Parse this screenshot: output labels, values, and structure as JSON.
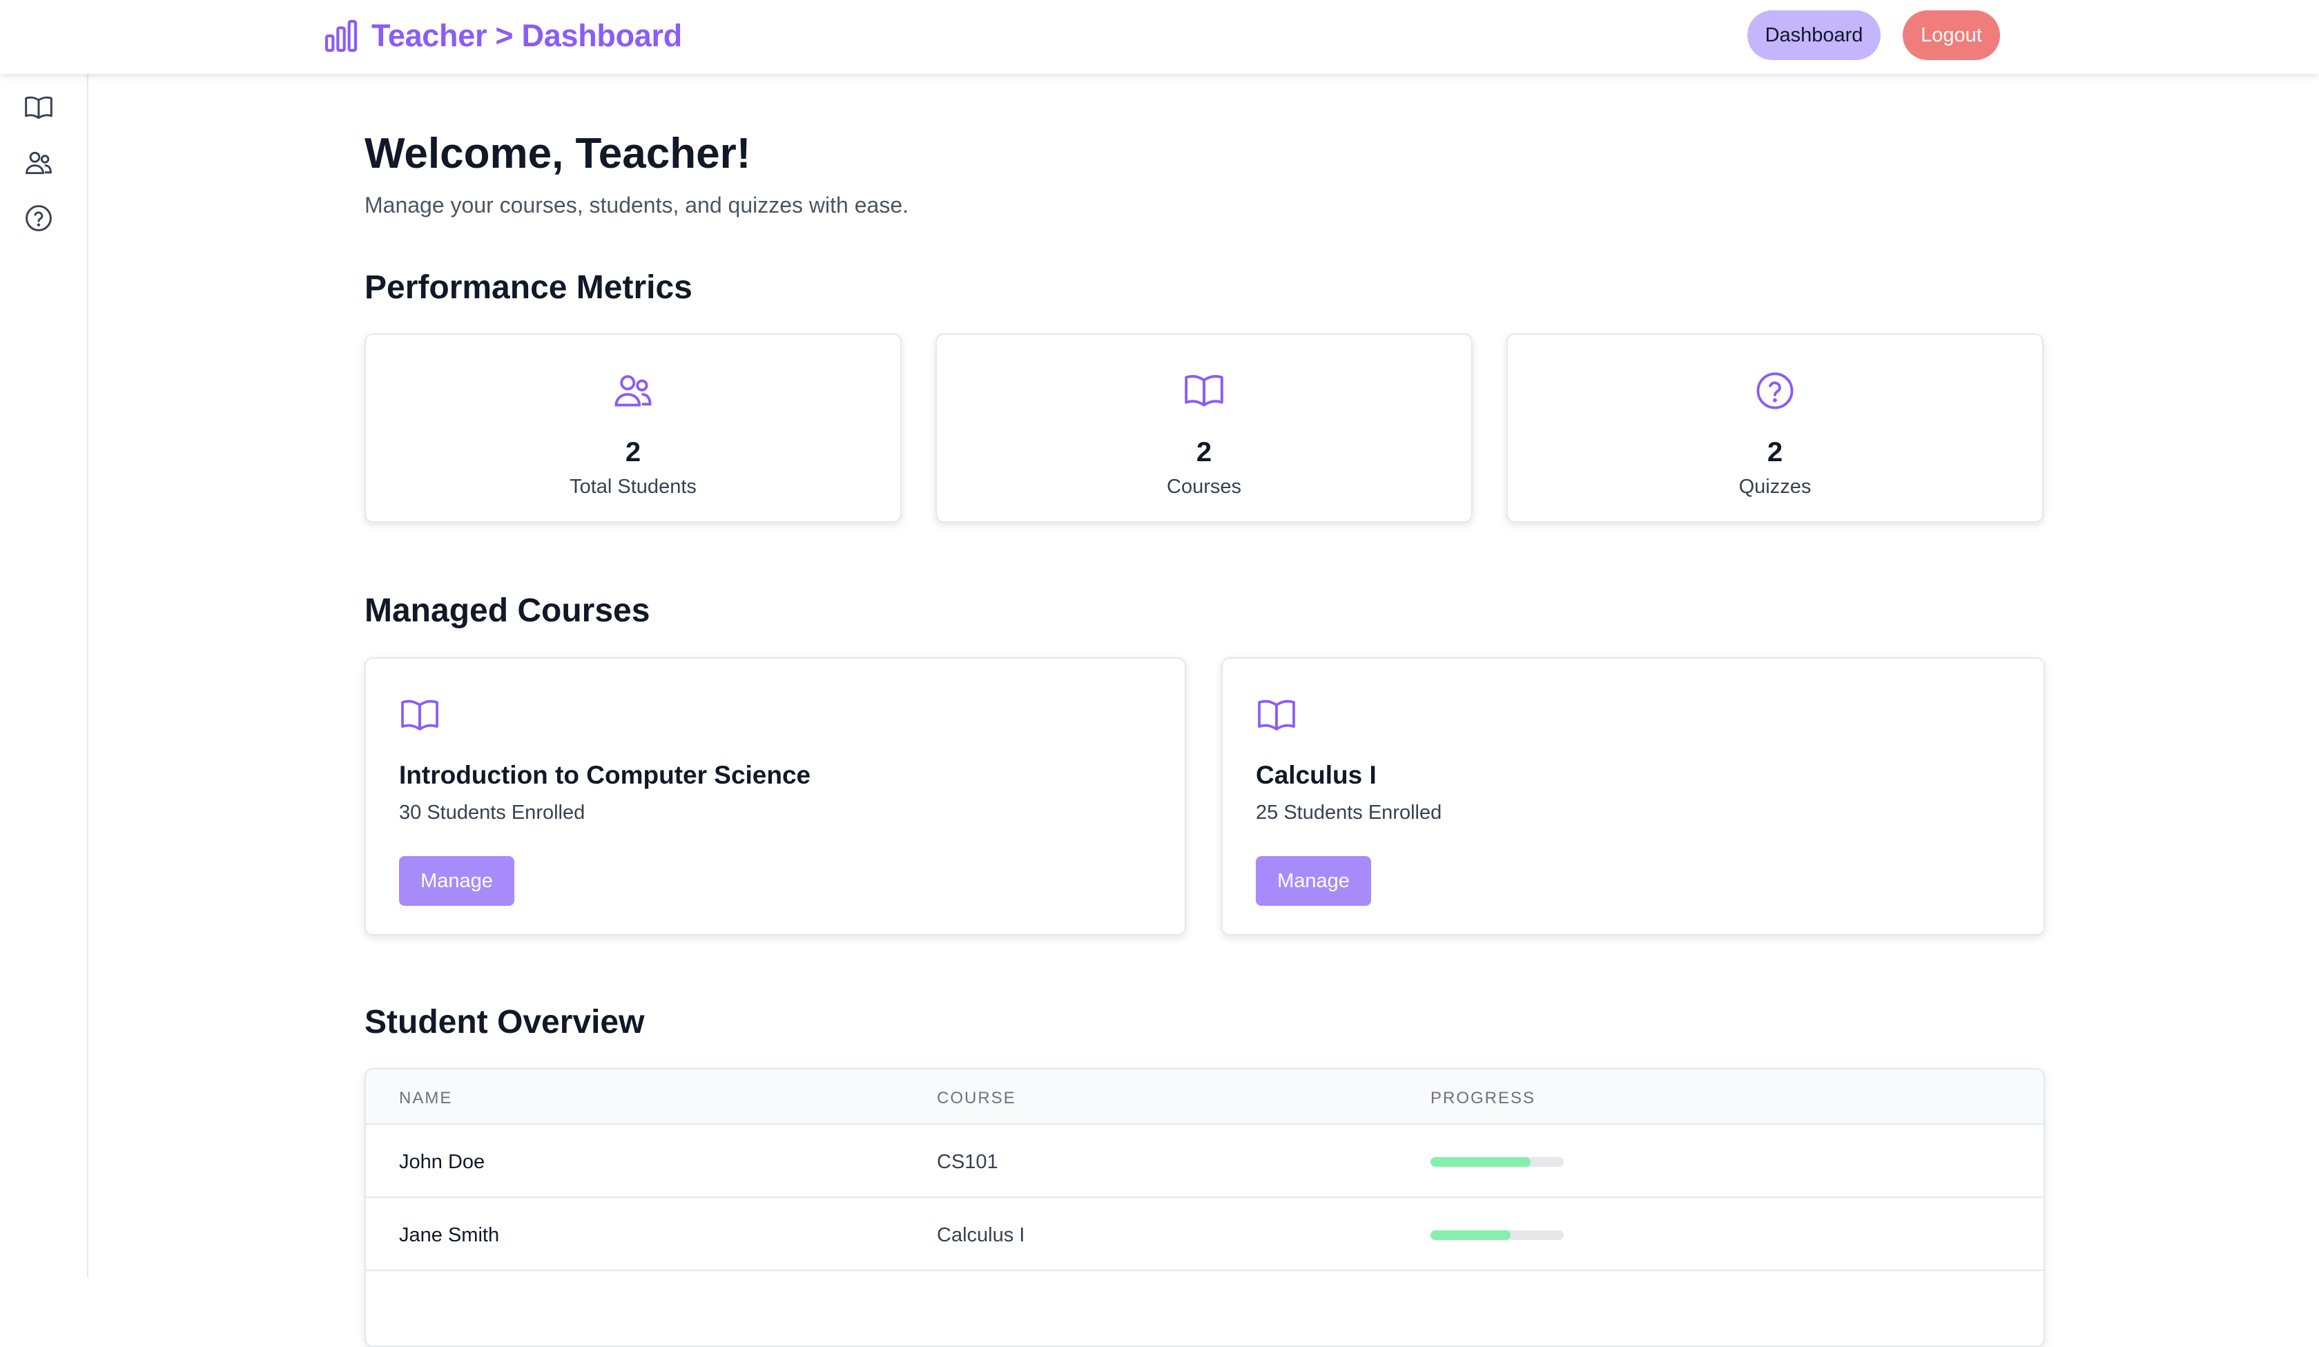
{
  "header": {
    "title": "Teacher > Dashboard",
    "dashboard_label": "Dashboard",
    "logout_label": "Logout"
  },
  "sidebar": {
    "items": [
      {
        "icon": "book-icon"
      },
      {
        "icon": "users-icon"
      },
      {
        "icon": "help-circle-icon"
      }
    ]
  },
  "welcome": {
    "title": "Welcome, Teacher!",
    "subtitle": "Manage your courses, students, and quizzes with ease."
  },
  "metrics": {
    "section_title": "Performance Metrics",
    "cards": [
      {
        "icon": "users-icon",
        "value": "2",
        "label": "Total Students"
      },
      {
        "icon": "book-icon",
        "value": "2",
        "label": "Courses"
      },
      {
        "icon": "help-circle-icon",
        "value": "2",
        "label": "Quizzes"
      }
    ]
  },
  "courses": {
    "section_title": "Managed Courses",
    "items": [
      {
        "name": "Introduction to Computer Science",
        "enrolled": "30 Students Enrolled",
        "button": "Manage"
      },
      {
        "name": "Calculus I",
        "enrolled": "25 Students Enrolled",
        "button": "Manage"
      }
    ]
  },
  "students": {
    "section_title": "Student Overview",
    "columns": [
      "NAME",
      "COURSE",
      "PROGRESS"
    ],
    "rows": [
      {
        "name": "John Doe",
        "course": "CS101",
        "progress": 0.75
      },
      {
        "name": "Jane Smith",
        "course": "Calculus I",
        "progress": 0.6
      }
    ]
  },
  "colors": {
    "accent": "#8b5cf6",
    "dashboard_pill": "#c4b5fd",
    "logout_pill": "#f07c7c",
    "manage_button": "#a78bfa",
    "progress_fill": "#86efac"
  }
}
